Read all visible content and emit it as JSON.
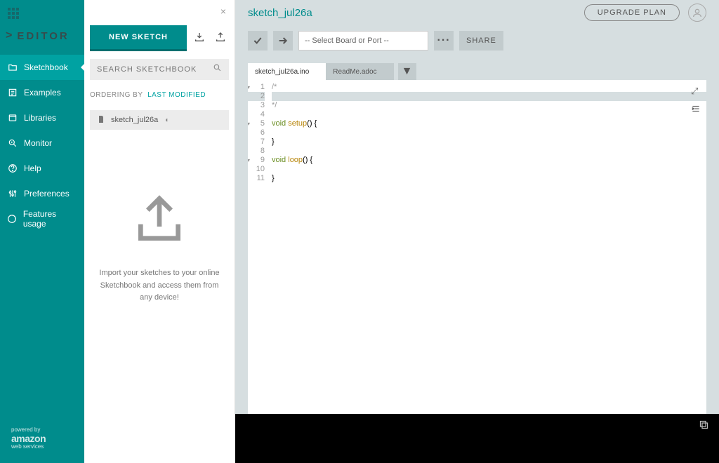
{
  "sidebar": {
    "logo": "EDITOR",
    "items": [
      {
        "label": "Sketchbook"
      },
      {
        "label": "Examples"
      },
      {
        "label": "Libraries"
      },
      {
        "label": "Monitor"
      },
      {
        "label": "Help"
      },
      {
        "label": "Preferences"
      },
      {
        "label": "Features usage"
      }
    ],
    "footer": {
      "powered": "powered by",
      "brand": "amazon",
      "sub": "web services"
    }
  },
  "middle": {
    "new_sketch": "NEW SKETCH",
    "search_placeholder": "SEARCH SKETCHBOOK",
    "ordering_label": "ORDERING BY",
    "ordering_value": "LAST MODIFIED",
    "sketch_item": "sketch_jul26a",
    "import_text": "Import your sketches to your online Sketchbook and access them from any device!"
  },
  "top": {
    "title": "sketch_jul26a",
    "upgrade": "UPGRADE PLAN"
  },
  "toolbar": {
    "board_placeholder": "-- Select Board or Port --",
    "share": "SHARE"
  },
  "tabs": [
    {
      "label": "sketch_jul26a.ino",
      "active": true
    },
    {
      "label": "ReadMe.adoc",
      "active": false
    }
  ],
  "code": {
    "lines": [
      {
        "n": 1,
        "fold": true,
        "cls": "cm",
        "text": "/*"
      },
      {
        "n": 2,
        "fold": false,
        "cls": "active",
        "text": ""
      },
      {
        "n": 3,
        "fold": false,
        "cls": "cm",
        "text": "*/"
      },
      {
        "n": 4,
        "fold": false,
        "cls": "",
        "text": ""
      },
      {
        "n": 5,
        "fold": true,
        "cls": "",
        "raw": "<span class=\"kw\">void</span> <span class=\"fn\">setup</span>() {"
      },
      {
        "n": 6,
        "fold": false,
        "cls": "",
        "text": "  "
      },
      {
        "n": 7,
        "fold": false,
        "cls": "",
        "text": "}"
      },
      {
        "n": 8,
        "fold": false,
        "cls": "",
        "text": ""
      },
      {
        "n": 9,
        "fold": true,
        "cls": "",
        "raw": "<span class=\"kw\">void</span> <span class=\"fn\">loop</span>() {"
      },
      {
        "n": 10,
        "fold": false,
        "cls": "",
        "text": "  "
      },
      {
        "n": 11,
        "fold": false,
        "cls": "",
        "text": "}"
      }
    ]
  }
}
